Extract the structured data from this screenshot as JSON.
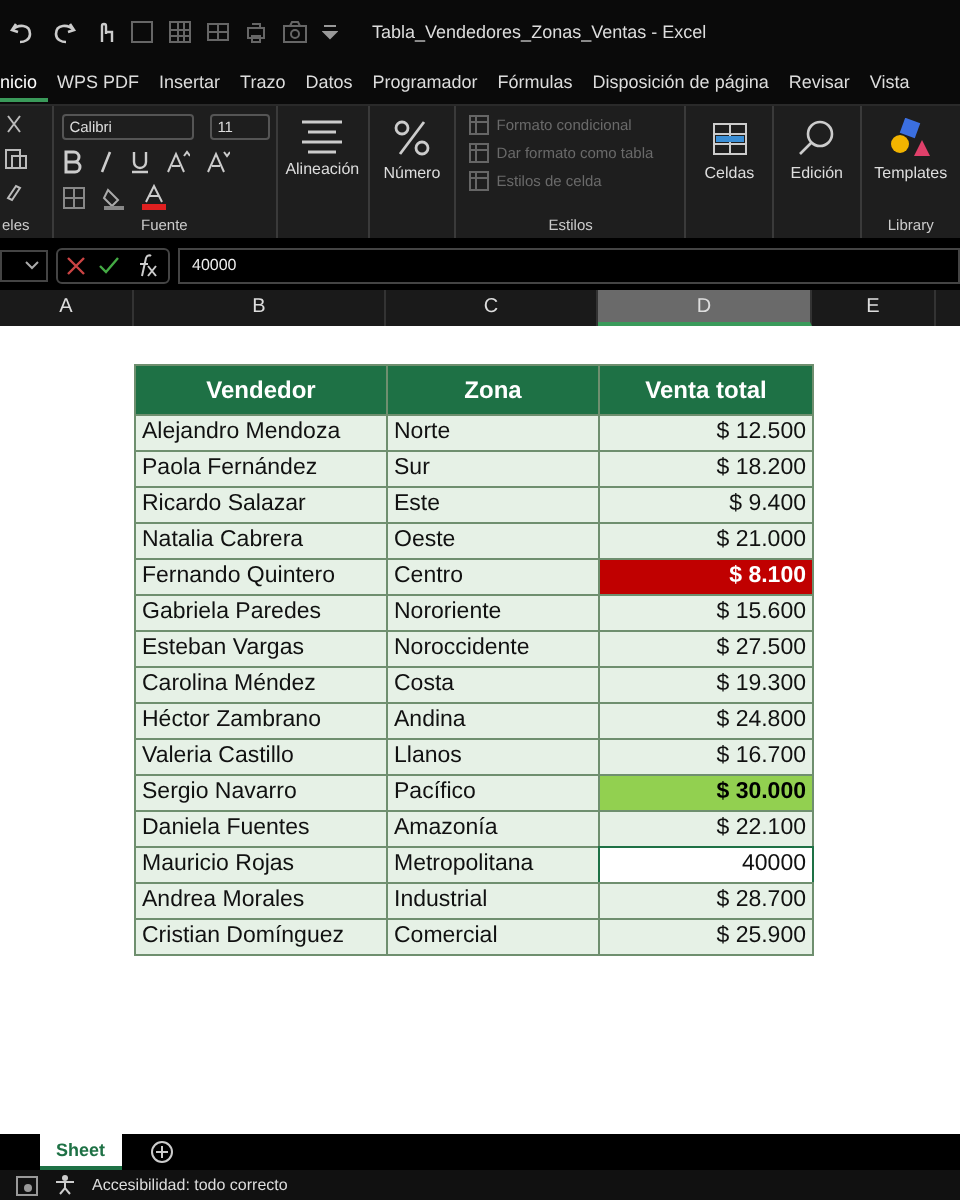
{
  "window": {
    "title": "Tabla_Vendedores_Zonas_Ventas  -  Excel"
  },
  "tabs": [
    {
      "label": "nicio",
      "selected": true
    },
    {
      "label": "WPS PDF",
      "selected": false
    },
    {
      "label": "Insertar",
      "selected": false
    },
    {
      "label": "Trazo",
      "selected": false
    },
    {
      "label": "Datos",
      "selected": false
    },
    {
      "label": "Programador",
      "selected": false
    },
    {
      "label": "Fórmulas",
      "selected": false
    },
    {
      "label": "Disposición de página",
      "selected": false
    },
    {
      "label": "Revisar",
      "selected": false
    },
    {
      "label": "Vista",
      "selected": false
    }
  ],
  "ribbon": {
    "clipboard_label": "eles",
    "font_name": "Calibri",
    "font_size": "11",
    "font_label": "Fuente",
    "alignment": "Alineación",
    "number": "Número",
    "styles": [
      {
        "label": "Formato condicional",
        "disabled": true
      },
      {
        "label": "Dar formato como tabla",
        "disabled": true
      },
      {
        "label": "Estilos de celda",
        "disabled": true
      }
    ],
    "styles_label": "Estilos",
    "cells": "Celdas",
    "editing": "Edición",
    "templates": "Templates",
    "library_label": "Library"
  },
  "formula_bar": {
    "value": "40000"
  },
  "column_headers": [
    {
      "label": "A",
      "selected": false
    },
    {
      "label": "B",
      "selected": false
    },
    {
      "label": "C",
      "selected": false
    },
    {
      "label": "D",
      "selected": true
    },
    {
      "label": "E",
      "selected": false
    }
  ],
  "table": {
    "columns": [
      "Vendedor",
      "Zona",
      "Venta total"
    ],
    "rows": [
      {
        "vendedor": "Alejandro Mendoza",
        "zona": "Norte",
        "venta": "$ 12.500",
        "kind": "normal"
      },
      {
        "vendedor": "Paola Fernández",
        "zona": "Sur",
        "venta": "$ 18.200",
        "kind": "normal"
      },
      {
        "vendedor": "Ricardo Salazar",
        "zona": "Este",
        "venta": "$ 9.400",
        "kind": "normal"
      },
      {
        "vendedor": "Natalia Cabrera",
        "zona": "Oeste",
        "venta": "$ 21.000",
        "kind": "normal"
      },
      {
        "vendedor": "Fernando Quintero",
        "zona": "Centro",
        "venta": "$ 8.100",
        "kind": "low"
      },
      {
        "vendedor": "Gabriela Paredes",
        "zona": "Nororiente",
        "venta": "$ 15.600",
        "kind": "normal"
      },
      {
        "vendedor": "Esteban Vargas",
        "zona": "Noroccidente",
        "venta": "$ 27.500",
        "kind": "normal"
      },
      {
        "vendedor": "Carolina Méndez",
        "zona": "Costa",
        "venta": "$ 19.300",
        "kind": "normal"
      },
      {
        "vendedor": "Héctor Zambrano",
        "zona": "Andina",
        "venta": "$ 24.800",
        "kind": "normal"
      },
      {
        "vendedor": "Valeria Castillo",
        "zona": "Llanos",
        "venta": "$ 16.700",
        "kind": "normal"
      },
      {
        "vendedor": "Sergio Navarro",
        "zona": "Pacífico",
        "venta": "$ 30.000",
        "kind": "high"
      },
      {
        "vendedor": "Daniela Fuentes",
        "zona": "Amazonía",
        "venta": "$ 22.100",
        "kind": "normal"
      },
      {
        "vendedor": "Mauricio Rojas",
        "zona": "Metropolitana",
        "venta": "40000",
        "kind": "editing"
      },
      {
        "vendedor": "Andrea Morales",
        "zona": "Industrial",
        "venta": "$ 28.700",
        "kind": "normal"
      },
      {
        "vendedor": "Cristian Domínguez",
        "zona": "Comercial",
        "venta": "$ 25.900",
        "kind": "normal"
      }
    ]
  },
  "sheet_tabs": [
    {
      "label": "Sheet",
      "selected": true
    }
  ],
  "status_bar": {
    "text": "Accesibilidad: todo correcto"
  }
}
